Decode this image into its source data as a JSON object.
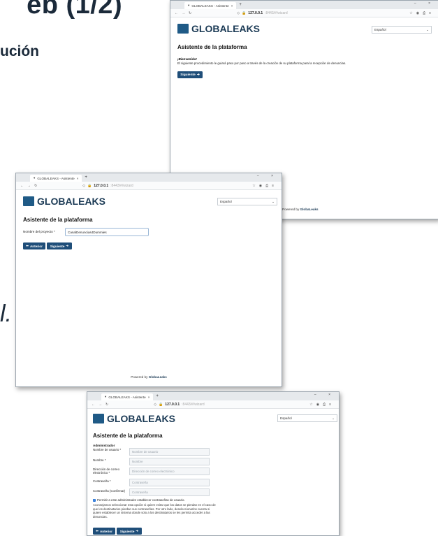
{
  "slide": {
    "title_text": "eb (1/2)",
    "subtitle_text": "ución",
    "side_text": "l."
  },
  "browser": {
    "tab_title": "GLOBALEAKS - Asistente",
    "url_host": "127.0.0.1",
    "url_path": ":8443/#/wizard",
    "new_tab": "+",
    "window_controls": "– ×"
  },
  "app": {
    "brand": "GLOBALEAKS",
    "language": "Español",
    "wizard_title": "Asistente de la plataforma",
    "footer_prefix": "Powered by",
    "footer_brand": "GlobaLeaks"
  },
  "window1": {
    "welcome_heading": "¡Bienvenido!",
    "welcome_text": "El siguiente procedimiento le guiará paso por paso a través de la creación de su plataforma para la recepción de denuncias.",
    "next_label": "Siguiente"
  },
  "window2": {
    "project_label": "Nombre del proyecto *",
    "project_value": "CanalDenuncias4Dummies",
    "prev_label": "Anterior",
    "next_label": "Siguiente"
  },
  "window3": {
    "section": "Administrador",
    "fields": [
      {
        "label": "Nombre de usuario *",
        "placeholder": "Nombre de usuario"
      },
      {
        "label": "Nombre *",
        "placeholder": "Nombre"
      },
      {
        "label": "Dirección de correo electrónico *",
        "placeholder": "Dirección de correo electrónico"
      },
      {
        "label": "Contraseña *",
        "placeholder": "Contraseña"
      },
      {
        "label": "Contraseña (Confirmar)",
        "placeholder": "Contraseña"
      }
    ],
    "checkbox_label": "Permitir a este administrador establecer contraseñas de usuario.",
    "checkbox_checked": true,
    "checkbox_help": "Aconsejamos seleccionar esta opción si quiere evitar que los datos se pierdan en el caso de que los destinatarios pierdan sus contraseñas. Por otro lado, deseleccionarlos cuenta si quiere establecer un sistema donde solo a los destinatarios se les permita acceder a las denuncias.",
    "prev_label": "Anterior",
    "next_label": "Siguiente"
  },
  "colors": {
    "brand_blue": "#1f4e79",
    "logo_blue": "#1f5a86"
  }
}
